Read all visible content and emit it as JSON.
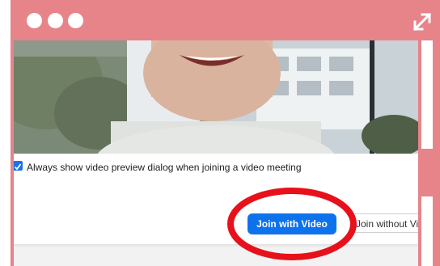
{
  "window": {
    "controls": [
      "dot-icon",
      "dot-icon",
      "dot-icon"
    ],
    "expand_icon": "expand-icon",
    "frame_color": "#e6848a"
  },
  "dialog": {
    "checkbox_checked": true,
    "checkbox_label": "Always show video preview dialog when joining a video meeting",
    "join_with_video_label": "Join with Video",
    "join_without_video_label": "Join without Video"
  },
  "colors": {
    "primary_button": "#0e72ed",
    "highlight_circle": "#e8101a",
    "checkbox": "#1a73e8"
  }
}
